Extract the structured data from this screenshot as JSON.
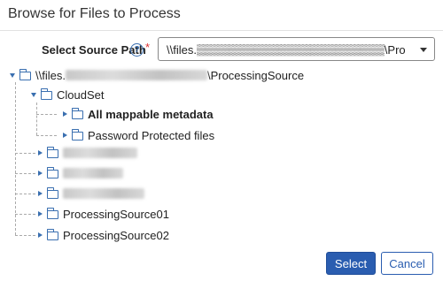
{
  "dialog": {
    "title": "Browse for Files to Process"
  },
  "source_path": {
    "label": "Select Source Path",
    "help_glyph": "?",
    "required_mark": "*",
    "selected_value": "\\\\files.▒▒▒▒▒▒▒▒▒▒▒▒▒▒▒▒▒▒▒▒▒▒▒\\Processing..."
  },
  "tree": {
    "root": {
      "prefix": "\\\\files.",
      "suffix": "\\ProcessingSource"
    },
    "cloudset": {
      "label": "CloudSet"
    },
    "all_mappable": {
      "label": "All mappable metadata"
    },
    "password_protected": {
      "label": "Password Protected files"
    },
    "processing_source_01": {
      "label": "ProcessingSource01"
    },
    "processing_source_02": {
      "label": "ProcessingSource02"
    }
  },
  "buttons": {
    "select": "Select",
    "cancel": "Cancel"
  },
  "colors": {
    "accent": "#2a5db0",
    "icon": "#3a6fb0",
    "required": "#dd3333"
  },
  "icons": [
    "help-icon",
    "caret-down-icon",
    "expander-icon",
    "folder-icon"
  ]
}
